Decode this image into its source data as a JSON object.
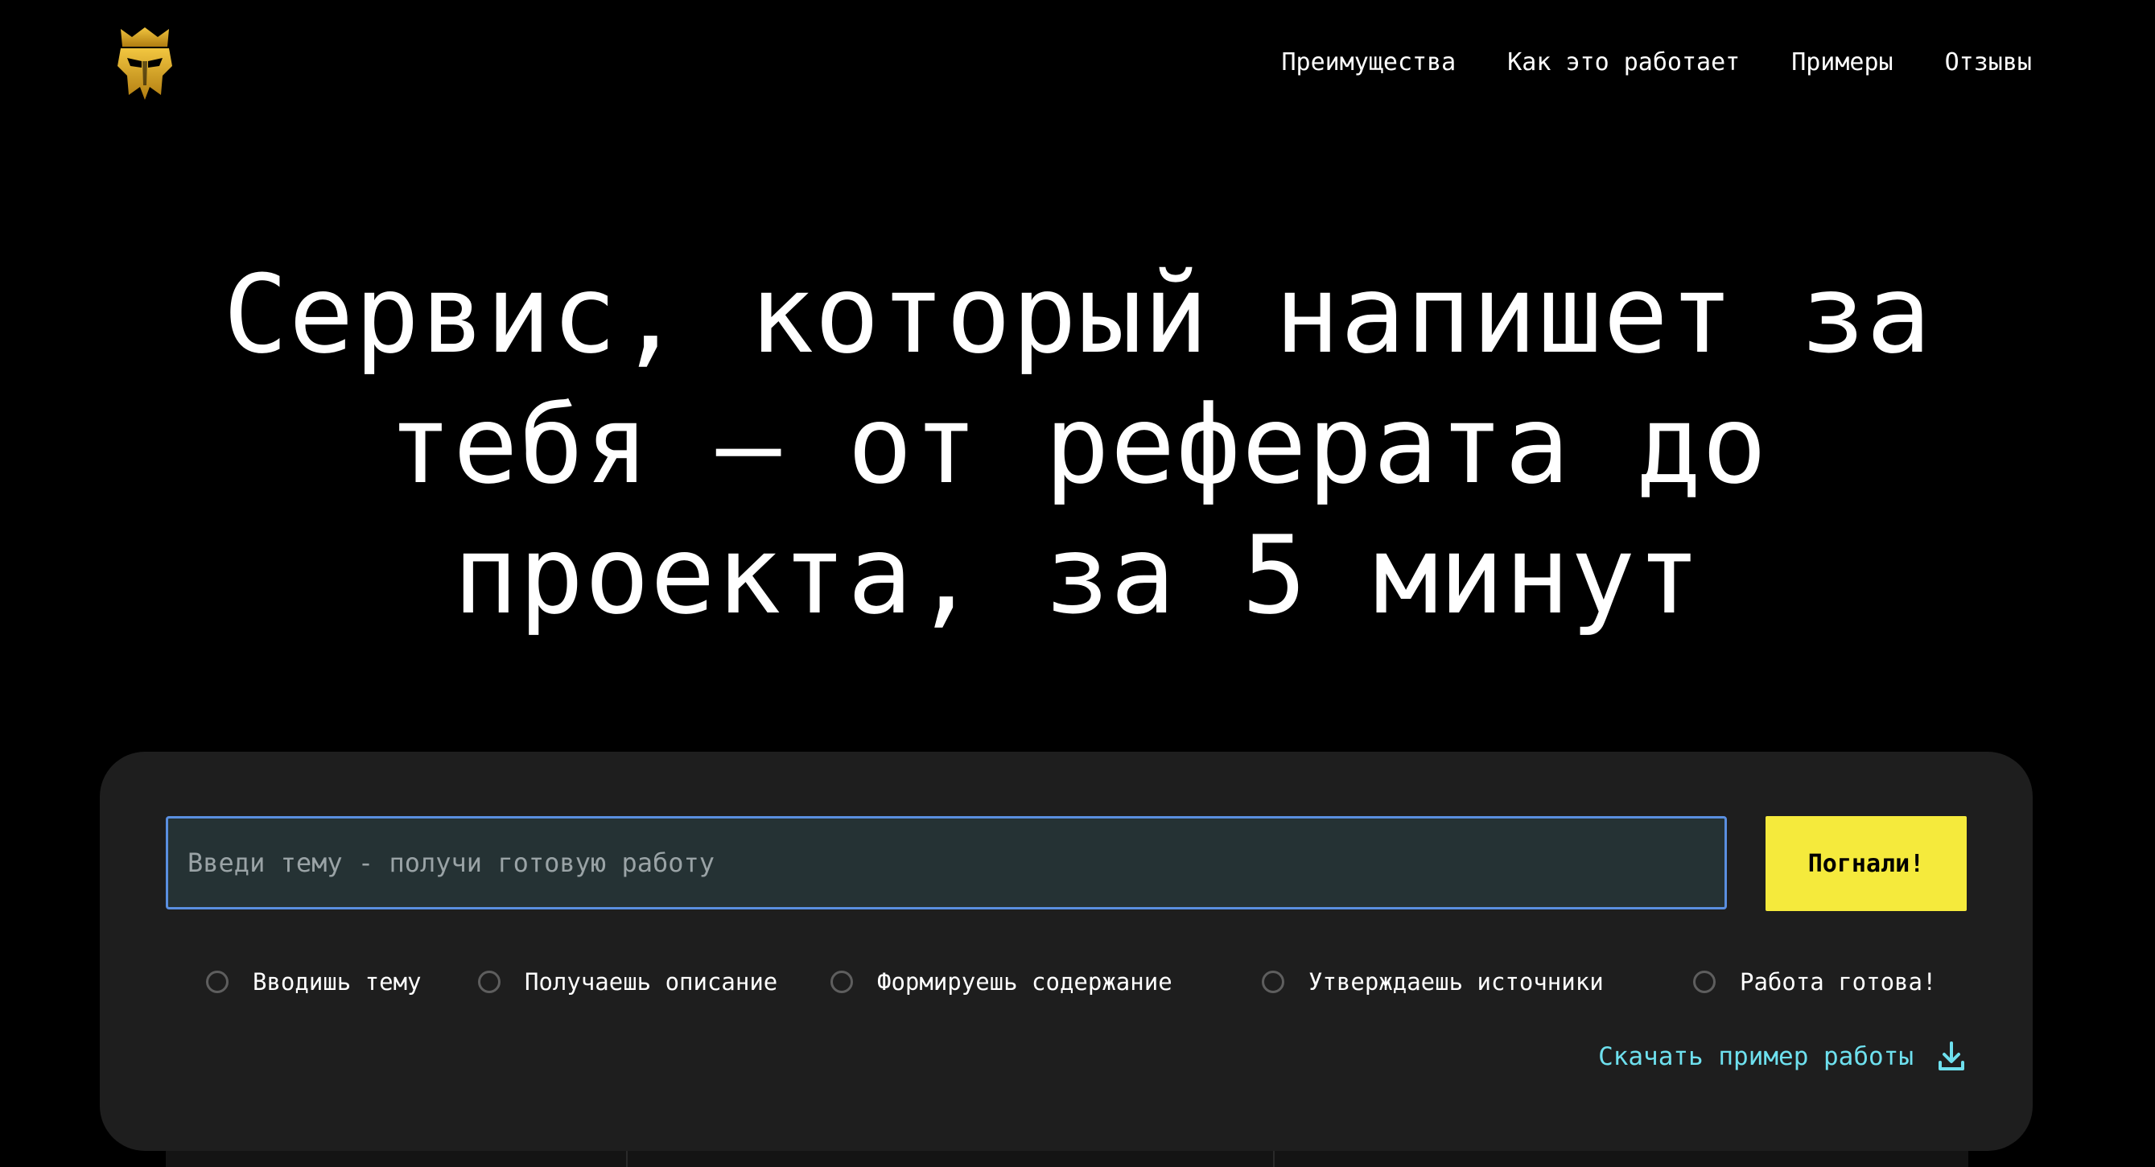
{
  "header": {
    "logo_icon": "spartan-helmet-icon",
    "nav": [
      {
        "label": "Преимущества"
      },
      {
        "label": "Как это работает"
      },
      {
        "label": "Примеры"
      },
      {
        "label": "Отзывы"
      }
    ]
  },
  "hero": {
    "title": "Сервис, который напишет за\nтебя — от реферата до\nпроекта, за 5 минут"
  },
  "form": {
    "input_value": "",
    "input_placeholder": "Введи тему - получи готовую работу",
    "submit_label": "Погнали!"
  },
  "steps": [
    {
      "label": "Вводишь тему"
    },
    {
      "label": "Получаешь описание"
    },
    {
      "label": "Формируешь содержание"
    },
    {
      "label": "Утверждаешь источники"
    },
    {
      "label": "Работа готова!"
    }
  ],
  "download": {
    "label": "Скачать пример работы",
    "icon": "download-icon"
  },
  "colors": {
    "background": "#000000",
    "card": "#1e1e1e",
    "accent_button": "#f5ea3c",
    "link": "#6ee0ee",
    "input_border": "#5a8fe0",
    "logo_gold": "#d9a520"
  }
}
